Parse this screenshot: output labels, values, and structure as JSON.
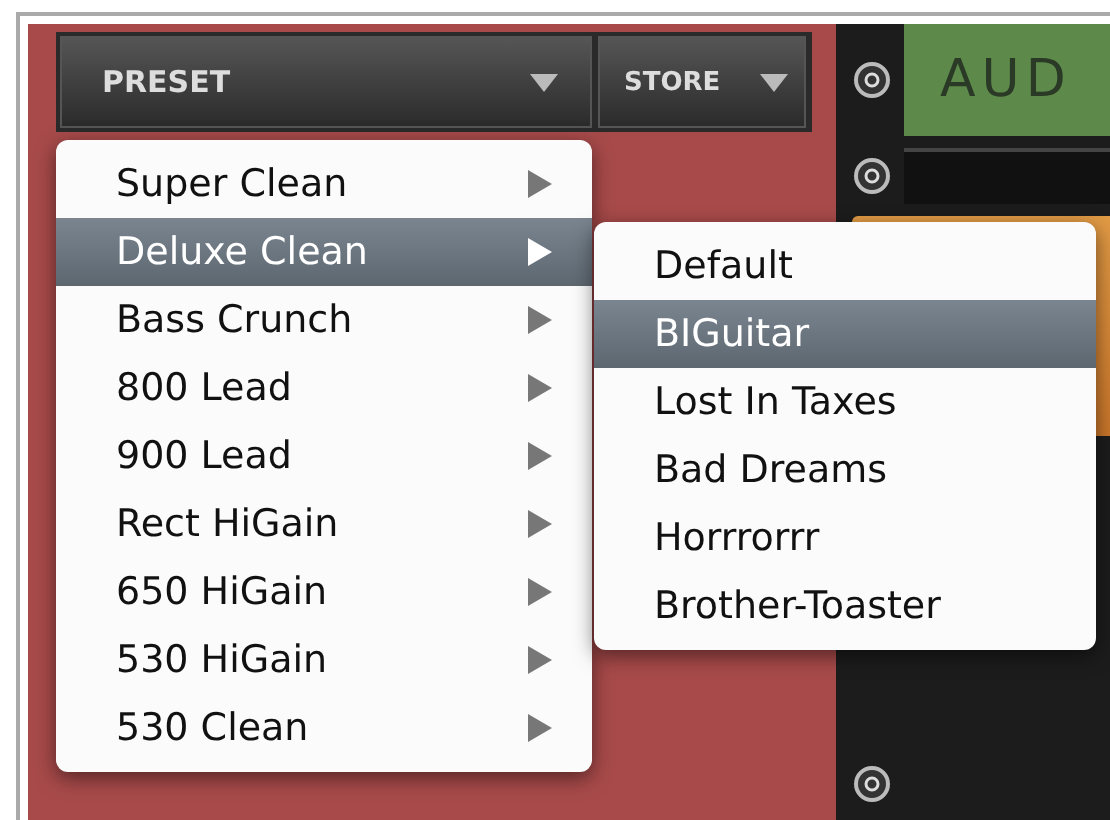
{
  "toolbar": {
    "preset_button": {
      "label": "PRESET"
    },
    "store_button": {
      "label": "STORE"
    }
  },
  "device_panel": {
    "label": "AUD"
  },
  "menu": {
    "items": [
      {
        "label": "Super Clean",
        "selected": false
      },
      {
        "label": "Deluxe Clean",
        "selected": true
      },
      {
        "label": "Bass Crunch",
        "selected": false
      },
      {
        "label": "800 Lead",
        "selected": false
      },
      {
        "label": "900 Lead",
        "selected": false
      },
      {
        "label": "Rect HiGain",
        "selected": false
      },
      {
        "label": "650 HiGain",
        "selected": false
      },
      {
        "label": "530 HiGain",
        "selected": false
      },
      {
        "label": "530 Clean",
        "selected": false
      }
    ]
  },
  "submenu": {
    "items": [
      {
        "label": "Default",
        "selected": false
      },
      {
        "label": "BIGuitar",
        "selected": true
      },
      {
        "label": "Lost In Taxes",
        "selected": false
      },
      {
        "label": "Bad Dreams",
        "selected": false
      },
      {
        "label": "Horrrorrr",
        "selected": false
      },
      {
        "label": "Brother-Toaster",
        "selected": false
      }
    ]
  }
}
